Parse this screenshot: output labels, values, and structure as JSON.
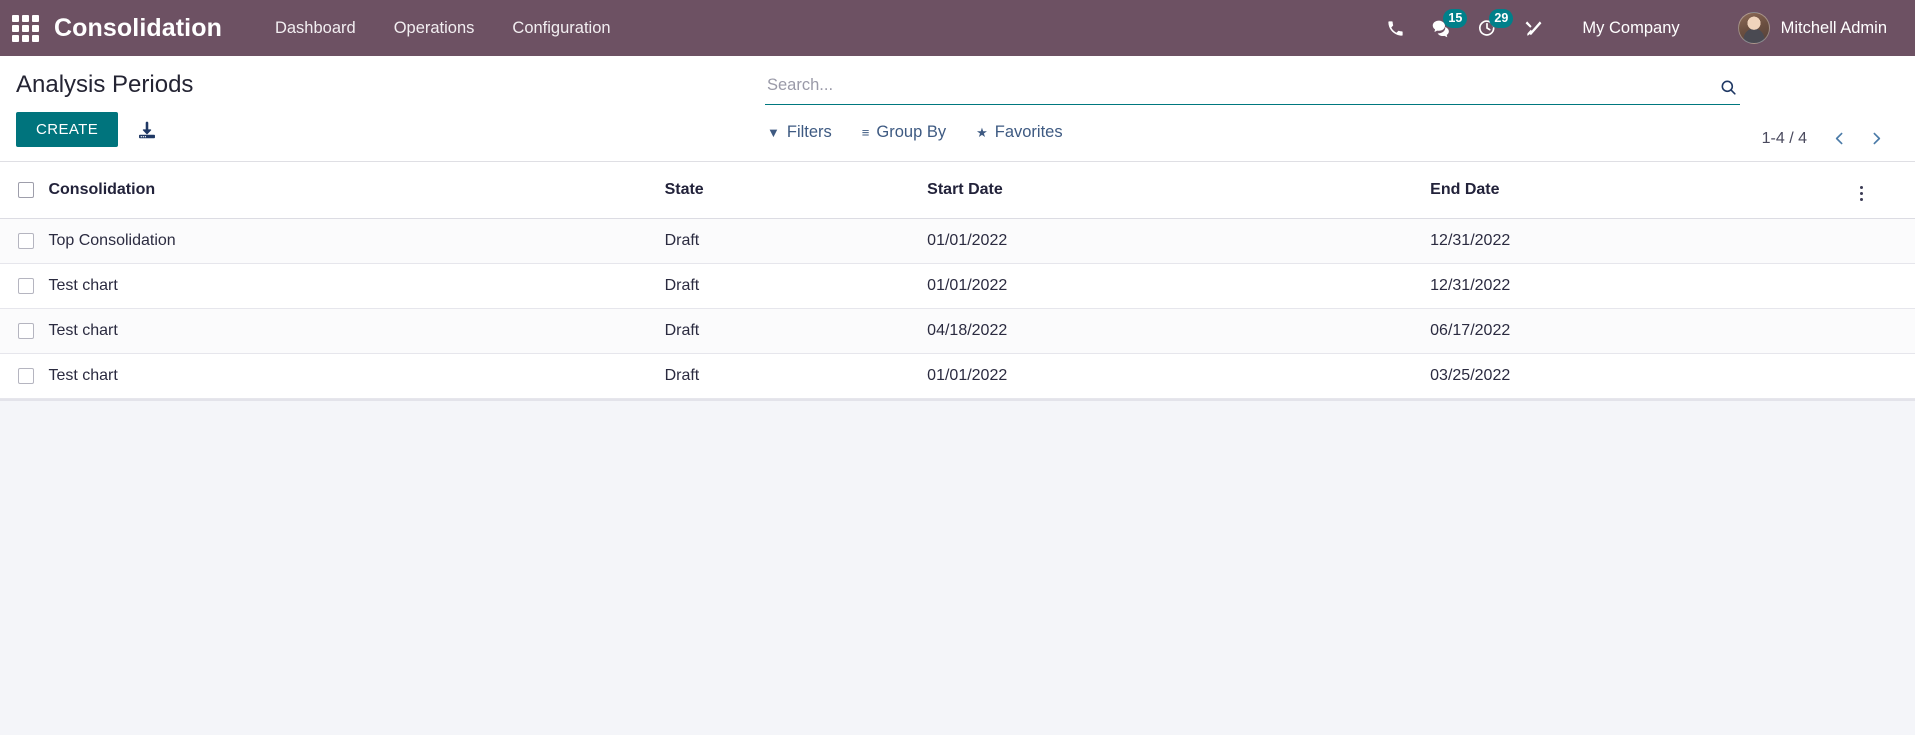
{
  "navbar": {
    "apps_icon": "apps-grid-icon",
    "brand": "Consolidation",
    "menu": [
      {
        "label": "Dashboard"
      },
      {
        "label": "Operations"
      },
      {
        "label": "Configuration"
      }
    ],
    "sys_icons": [
      {
        "name": "phone-icon",
        "badge": null
      },
      {
        "name": "messages-icon",
        "badge": "15"
      },
      {
        "name": "activities-clock-icon",
        "badge": "29"
      },
      {
        "name": "debug-tools-icon",
        "badge": null
      }
    ],
    "company": "My Company",
    "user": {
      "name": "Mitchell Admin",
      "avatar": "user-avatar"
    },
    "colors": {
      "navbar_bg": "#6d5163",
      "badge_bg": "#00808a",
      "text": "#ffffff"
    }
  },
  "control_panel": {
    "title": "Analysis Periods",
    "create_label": "CREATE",
    "import_icon": "import-download-icon",
    "search": {
      "value": "",
      "placeholder": "Search...",
      "search_icon": "search-magnifier-icon"
    },
    "facets": [
      {
        "label": "Filters",
        "icon": "filter-funnel-icon",
        "glyph": "▼"
      },
      {
        "label": "Group By",
        "icon": "group-by-lines-icon",
        "glyph": "≡"
      },
      {
        "label": "Favorites",
        "icon": "favorites-star-icon",
        "glyph": "★"
      }
    ],
    "pager": {
      "count": "1-4 / 4",
      "prev_icon": "chevron-left-icon",
      "next_icon": "chevron-right-icon"
    },
    "colors": {
      "create_bg": "#00747d",
      "search_underline": "#00787f",
      "facet_text": "#3e5a82"
    }
  },
  "list_view": {
    "columns": [
      {
        "key": "name",
        "label": "Consolidation"
      },
      {
        "key": "state",
        "label": "State"
      },
      {
        "key": "start",
        "label": "Start Date"
      },
      {
        "key": "end",
        "label": "End Date"
      }
    ],
    "optional_columns_icon": "column-options-icon",
    "select_all_checkbox": false,
    "rows": [
      {
        "selected": false,
        "name": "Top Consolidation",
        "state": "Draft",
        "start": "01/01/2022",
        "end": "12/31/2022"
      },
      {
        "selected": false,
        "name": "Test chart",
        "state": "Draft",
        "start": "01/01/2022",
        "end": "12/31/2022"
      },
      {
        "selected": false,
        "name": "Test chart",
        "state": "Draft",
        "start": "04/18/2022",
        "end": "06/17/2022"
      },
      {
        "selected": false,
        "name": "Test chart",
        "state": "Draft",
        "start": "01/01/2022",
        "end": "03/25/2022"
      }
    ]
  }
}
